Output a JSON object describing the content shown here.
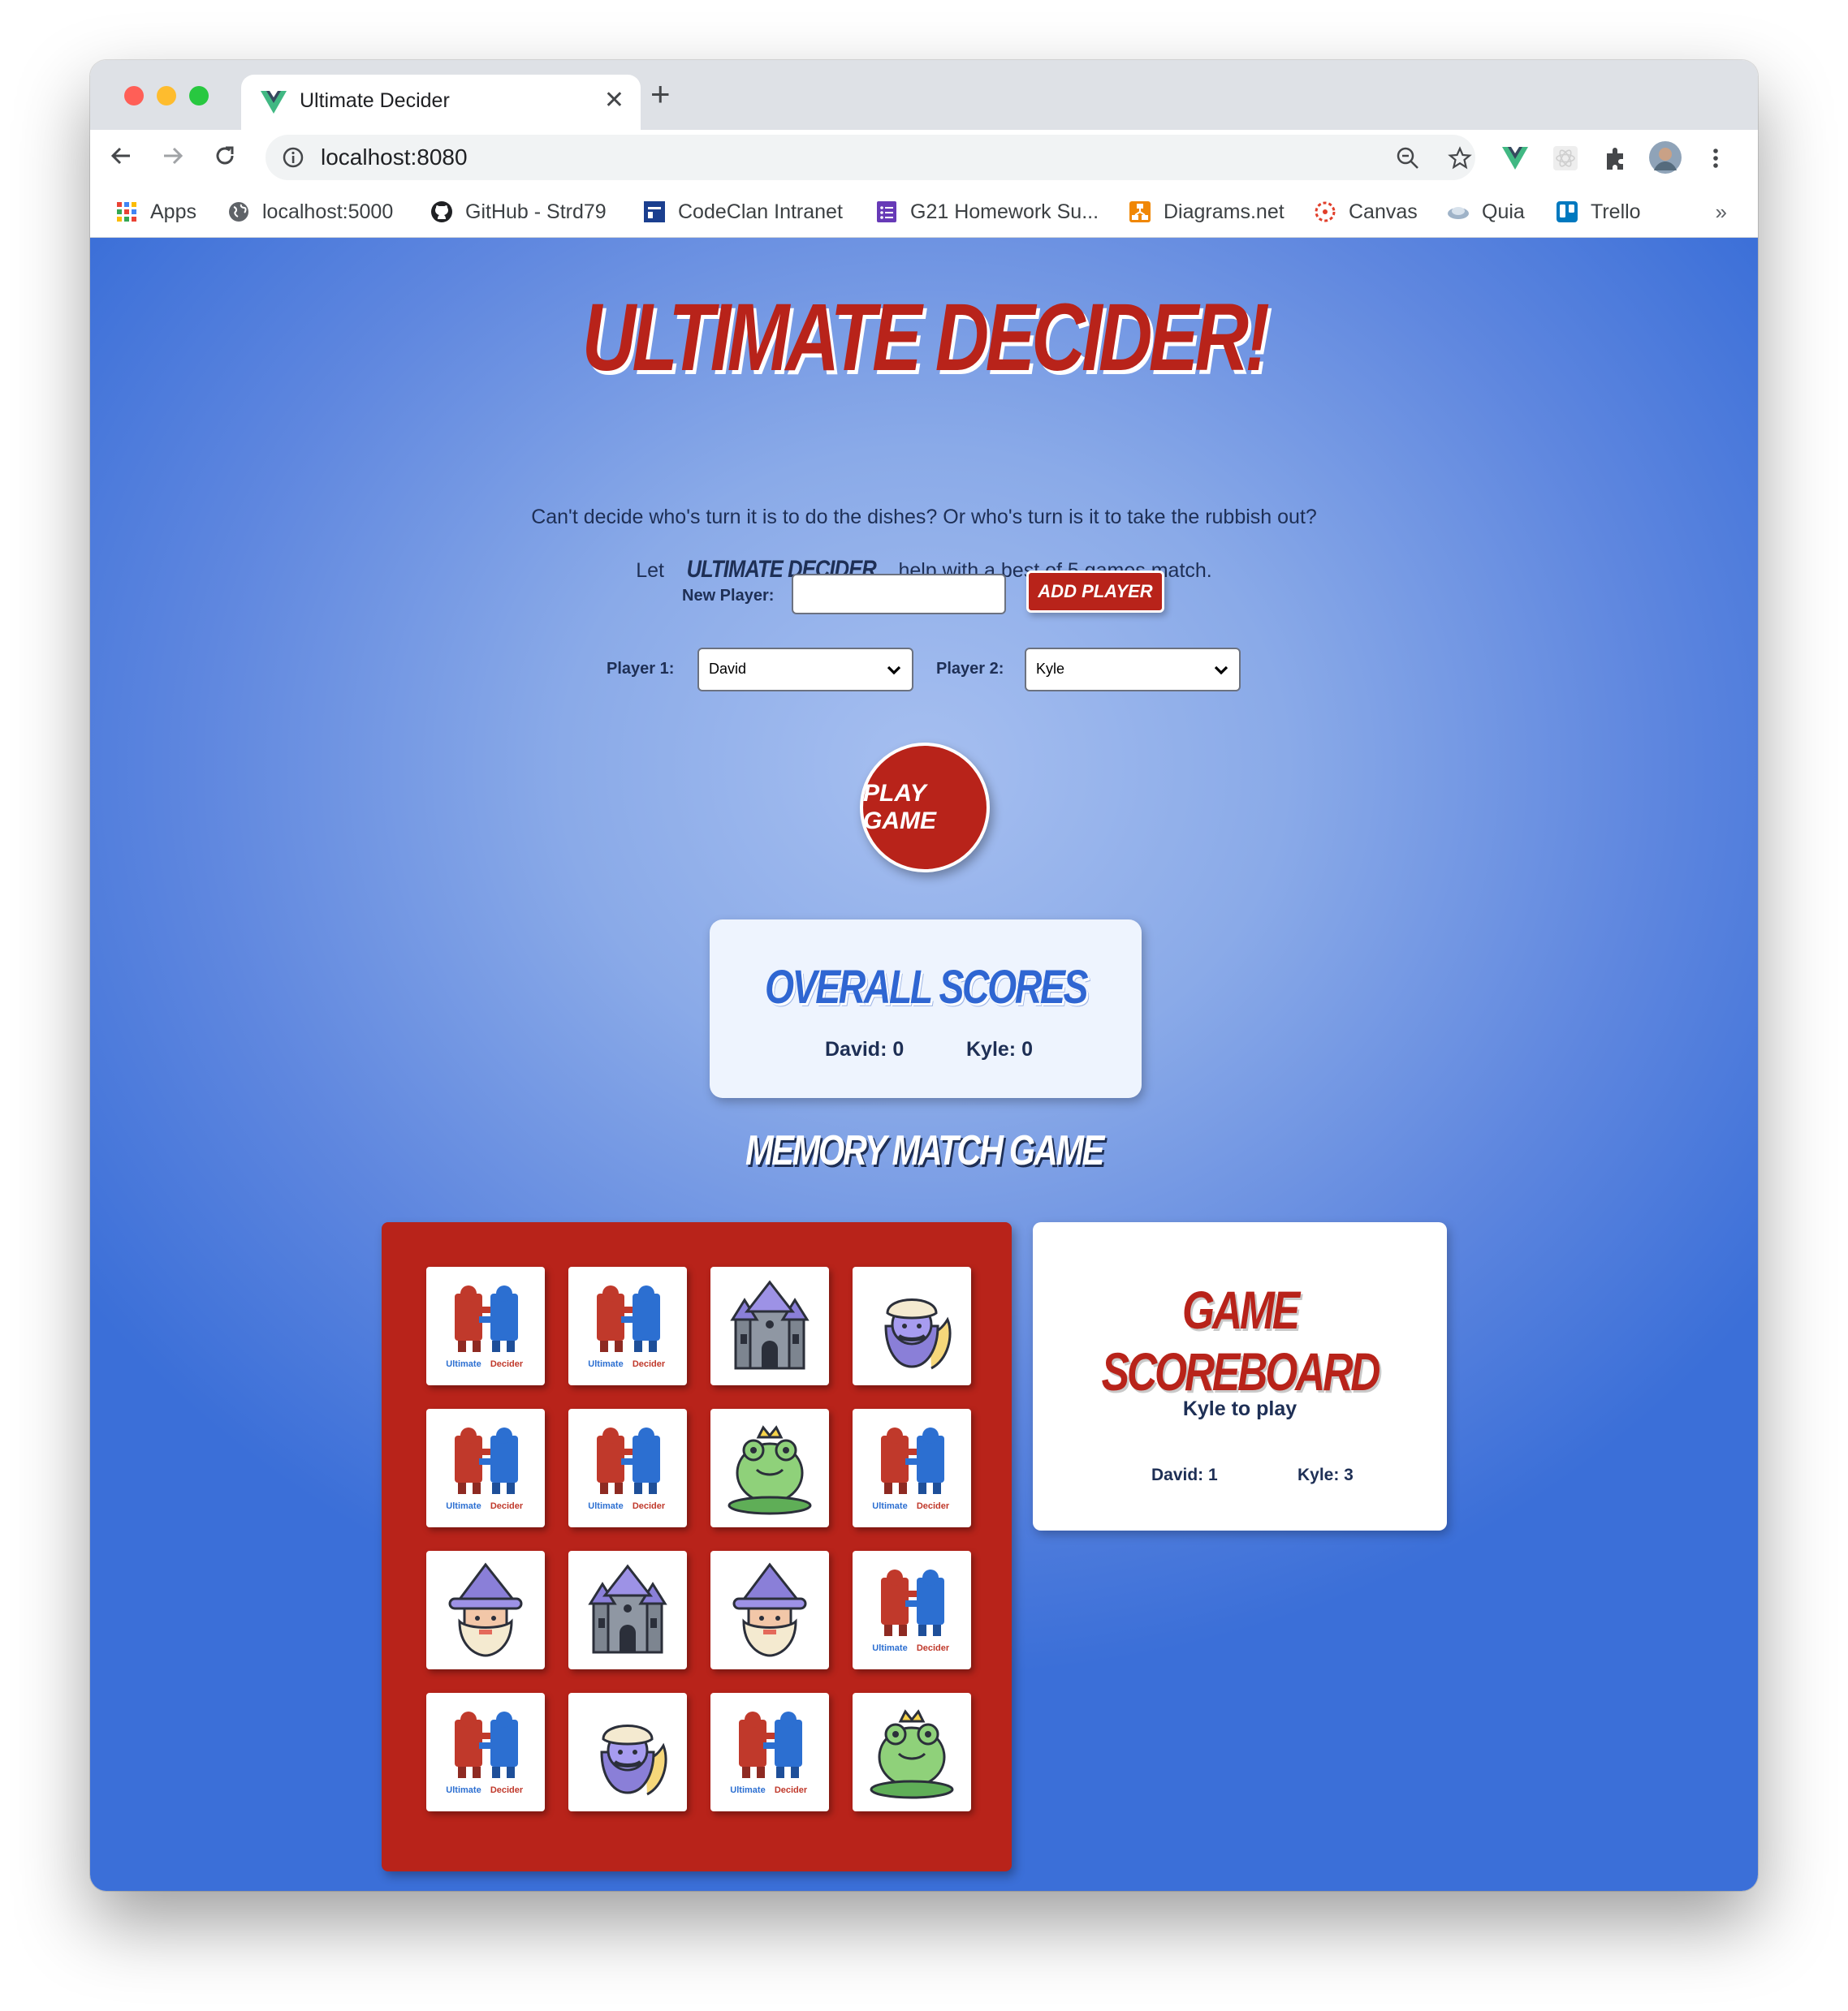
{
  "browser": {
    "tab_title": "Ultimate Decider",
    "url": "localhost:8080",
    "bookmarks": [
      {
        "label": "Apps",
        "icon": "apps-grid-icon"
      },
      {
        "label": "localhost:5000",
        "icon": "globe-icon"
      },
      {
        "label": "GitHub - Strd79",
        "icon": "github-icon"
      },
      {
        "label": "CodeClan Intranet",
        "icon": "codeclan-icon"
      },
      {
        "label": "G21 Homework Su...",
        "icon": "forms-icon"
      },
      {
        "label": "Diagrams.net",
        "icon": "diagrams-icon"
      },
      {
        "label": "Canvas",
        "icon": "canvas-icon"
      },
      {
        "label": "Quia",
        "icon": "quia-icon"
      },
      {
        "label": "Trello",
        "icon": "trello-icon"
      }
    ],
    "more_label": "»"
  },
  "page": {
    "title": "ULTIMATE DECIDER!",
    "intro_line1": "Can't decide who's turn it is to do the dishes? Or who's turn is it to take the rubbish out?",
    "intro_line2_before": "Let",
    "intro_line2_em": "ULTIMATE DECIDER",
    "intro_line2_after": "help with a best of 5 games match.",
    "new_player_label": "New Player:",
    "new_player_value": "",
    "add_player_label": "ADD PLAYER",
    "player1_label": "Player 1:",
    "player1_value": "David",
    "player2_label": "Player 2:",
    "player2_value": "Kyle",
    "play_game_label": "PLAY GAME"
  },
  "overall_scores": {
    "title": "OVERALL SCORES",
    "scores": [
      {
        "text": "David: 0"
      },
      {
        "text": "Kyle: 0"
      }
    ]
  },
  "memory_game": {
    "title": "MEMORY MATCH GAME",
    "cards": [
      "ultimate-decider-logo",
      "ultimate-decider-logo",
      "castle",
      "genie",
      "ultimate-decider-logo",
      "ultimate-decider-logo",
      "frog-prince",
      "ultimate-decider-logo",
      "wizard",
      "castle",
      "wizard",
      "ultimate-decider-logo",
      "ultimate-decider-logo",
      "genie",
      "ultimate-decider-logo",
      "frog-prince"
    ],
    "logo_words": [
      "Ultimate",
      "Decider"
    ]
  },
  "game_scoreboard": {
    "title": "GAME SCOREBOARD",
    "turn_text": "Kyle to play",
    "scores": [
      {
        "text": "David: 1"
      },
      {
        "text": "Kyle: 3"
      }
    ]
  },
  "colors": {
    "accent_red": "#b8231a",
    "accent_blue": "#2f66d2",
    "page_blue": "#3b6fd8"
  }
}
